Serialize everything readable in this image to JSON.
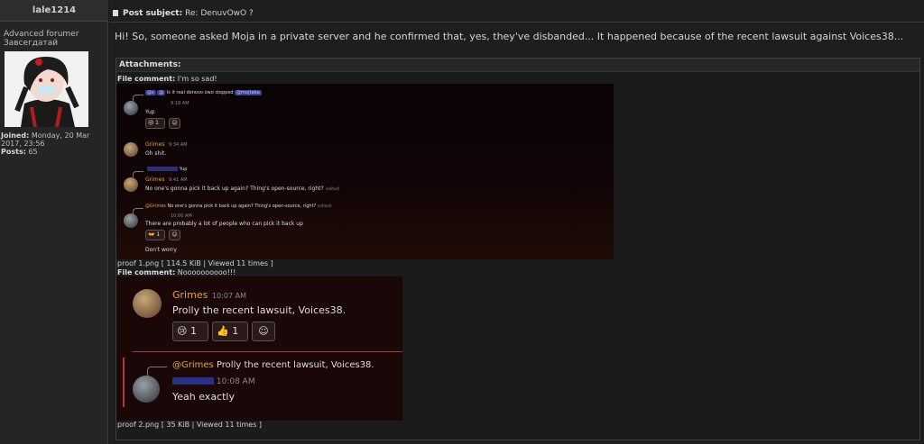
{
  "user": {
    "username": "lale1214",
    "rank_line1": "Advanced forumer",
    "rank_line2": "Завсегдатай",
    "joined_label": "Joined:",
    "joined_value": "Monday, 20 Mar 2017, 23:56",
    "posts_label": "Posts:",
    "posts_value": "65"
  },
  "post": {
    "subject_label": "Post subject:",
    "subject_value": "Re: DenuvOwO ?",
    "body": "Hi! So, someone asked Moja in a private server and he confirmed that, yes, they've disbanded... It happened because of the recent lawsuit against Voices38..."
  },
  "attachments": {
    "header": "Attachments:",
    "items": [
      {
        "comment_label": "File comment:",
        "comment": "I'm so sad!",
        "caption": "proof 1.png [ 114.5 KiB | Viewed 11 times ]"
      },
      {
        "comment_label": "File comment:",
        "comment": "Noooooooooo!!!",
        "caption": "proof 2.png [ 35 KiB | Viewed 11 times ]"
      }
    ]
  },
  "shot1": {
    "reply1_mention_a": "@s",
    "reply1_mention_b": "@",
    "reply1_text": "Is it real denovo owo stopped",
    "reply1_mention_c": "@mojtaba",
    "time1": "9:18 AM",
    "msg1": "Yup",
    "react1_count": "1",
    "grimes1_name": "Grimes",
    "grimes1_time": "9:34 AM",
    "grimes1_msg": "Oh shit.",
    "reply2_text": "Yup",
    "grimes2_name": "Grimes",
    "grimes2_time": "9:41 AM",
    "grimes2_msg": "No one's gonna pick it back up again? Thing's open-source, right?",
    "grimes2_edited": "(edited)",
    "reply3_mention": "@Grimes",
    "reply3_text": "No one's gonna pick it back up again? Thing's open-source, right?",
    "reply3_edited": "(edited)",
    "time3": "10:00 AM",
    "msg3": "There are probably a lot of people who can pick it back up",
    "react3_count": "1",
    "msg4": "Don't worry"
  },
  "shot2": {
    "name": "Grimes",
    "time": "10:07 AM",
    "msg": "Prolly the recent lawsuit, Voices38.",
    "react_a_count": "1",
    "react_b_count": "1",
    "reply_mention": "@Grimes",
    "reply_text": "Prolly the recent lawsuit, Voices38.",
    "time2": "10:08 AM",
    "msg2": "Yeah exactly"
  }
}
